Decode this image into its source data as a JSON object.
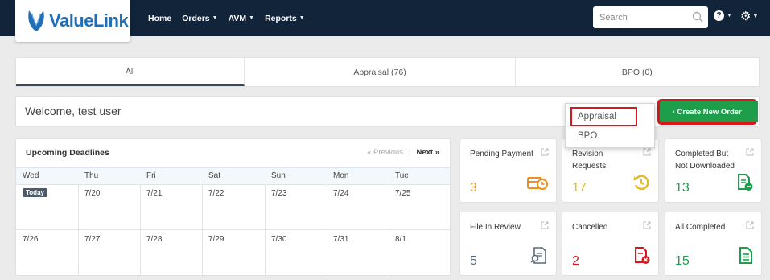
{
  "brand": {
    "name": "ValueLink",
    "accent": "#1f6fb8",
    "nav_bg": "#12243a"
  },
  "nav": {
    "items": [
      {
        "label": "Home",
        "caret": false
      },
      {
        "label": "Orders",
        "caret": true
      },
      {
        "label": "AVM",
        "caret": true
      },
      {
        "label": "Reports",
        "caret": true
      }
    ],
    "search_placeholder": "Search"
  },
  "tabs": [
    {
      "label": "All",
      "active": true
    },
    {
      "label": "Appraisal (76)",
      "active": false
    },
    {
      "label": "BPO (0)",
      "active": false
    }
  ],
  "welcome": {
    "text": "Welcome, test user",
    "create_label": "Create New Order"
  },
  "dropdown": {
    "items": [
      "Appraisal",
      "BPO"
    ],
    "highlighted": "Appraisal"
  },
  "calendar": {
    "title": "Upcoming Deadlines",
    "prev_label": "« Previous",
    "separator": "|",
    "next_label": "Next »",
    "days": [
      "Wed",
      "Thu",
      "Fri",
      "Sat",
      "Sun",
      "Mon",
      "Tue"
    ],
    "today_label": "Today",
    "week1": [
      "",
      "7/20",
      "7/21",
      "7/22",
      "7/23",
      "7/24",
      "7/25"
    ],
    "week2": [
      "7/26",
      "7/27",
      "7/28",
      "7/29",
      "7/30",
      "7/31",
      "8/1"
    ]
  },
  "cards": [
    {
      "label": "Pending Payment",
      "count": "3",
      "color": "#f0901e",
      "icon": "payment-clock-icon"
    },
    {
      "label": "Revision Requests",
      "count": "17",
      "color": "#e8b820",
      "icon": "revision-arrow-icon"
    },
    {
      "label": "Completed But Not Downloaded",
      "count": "13",
      "color": "#1e9e4a",
      "icon": "doc-download-icon"
    },
    {
      "label": "File In Review",
      "count": "5",
      "color": "#5a6a7a",
      "icon": "doc-search-icon"
    },
    {
      "label": "Cancelled",
      "count": "2",
      "color": "#d9161c",
      "icon": "doc-cancel-icon"
    },
    {
      "label": "All Completed",
      "count": "15",
      "color": "#1e9e4a",
      "icon": "doc-complete-icon"
    }
  ]
}
